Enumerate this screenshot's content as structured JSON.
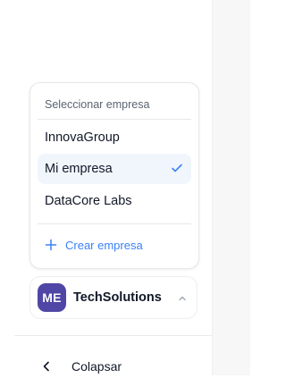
{
  "dropdown": {
    "header": "Seleccionar empresa",
    "companies": [
      {
        "label": "InnovaGroup",
        "selected": false
      },
      {
        "label": "Mi empresa",
        "selected": true
      },
      {
        "label": "DataCore Labs",
        "selected": false
      }
    ],
    "create_label": "Crear empresa"
  },
  "current_company": {
    "initials": "ME",
    "name": "TechSolutions"
  },
  "footer": {
    "collapse_label": "Colapsar"
  },
  "icons": {
    "check": "check-icon",
    "plus": "plus-icon",
    "chevron_up": "chevron-up-icon",
    "chevron_left": "chevron-left-icon"
  },
  "colors": {
    "accent": "#3b82f6",
    "avatar_bg": "#4f46a5",
    "selected_bg": "#f1f6fd",
    "text": "#111827",
    "muted": "#5b6472"
  }
}
